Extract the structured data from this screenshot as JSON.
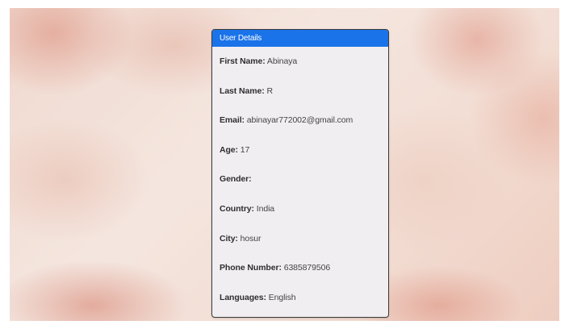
{
  "card": {
    "title": "User Details",
    "accent_color": "#1a73e8",
    "fields": [
      {
        "label": "First Name:",
        "value": "Abinaya"
      },
      {
        "label": "Last Name:",
        "value": "R"
      },
      {
        "label": "Email:",
        "value": "abinayar772002@gmail.com"
      },
      {
        "label": "Age:",
        "value": "17"
      },
      {
        "label": "Gender:",
        "value": ""
      },
      {
        "label": "Country:",
        "value": "India"
      },
      {
        "label": "City:",
        "value": "hosur"
      },
      {
        "label": "Phone Number:",
        "value": "6385879506"
      },
      {
        "label": "Languages:",
        "value": "English"
      }
    ]
  }
}
